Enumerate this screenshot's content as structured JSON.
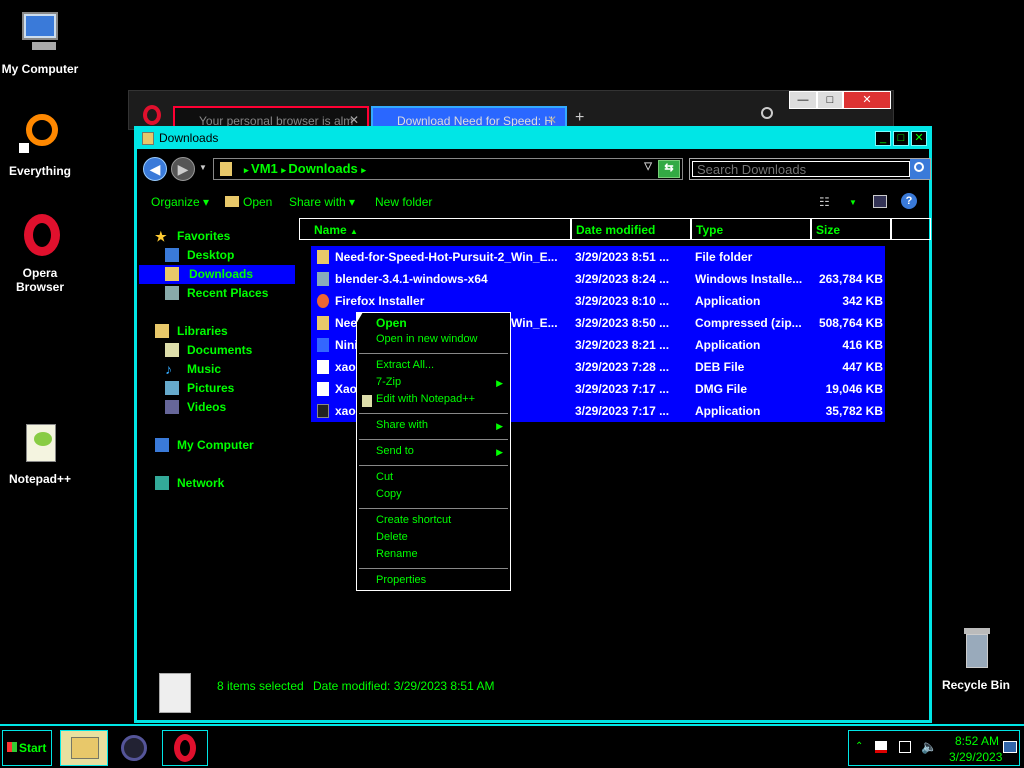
{
  "desktop": {
    "icons": [
      {
        "label": "My Computer"
      },
      {
        "label": "Everything"
      },
      {
        "label": "Opera Browser"
      },
      {
        "label": "Notepad++"
      },
      {
        "label": "Recycle Bin"
      }
    ]
  },
  "browser": {
    "tabs": [
      {
        "label": "Your personal browser is alm"
      },
      {
        "label": "Download Need for Speed: H"
      }
    ],
    "new_tab": "+"
  },
  "explorer": {
    "title": "Downloads",
    "breadcrumb": [
      "VM1",
      "Downloads"
    ],
    "search_placeholder": "Search Downloads",
    "toolbar": {
      "organize": "Organize",
      "open": "Open",
      "share_with": "Share with",
      "new_folder": "New folder"
    },
    "nav": {
      "favorites": "Favorites",
      "desktop": "Desktop",
      "downloads": "Downloads",
      "recent_places": "Recent Places",
      "libraries": "Libraries",
      "documents": "Documents",
      "music": "Music",
      "pictures": "Pictures",
      "videos": "Videos",
      "my_computer": "My Computer",
      "network": "Network"
    },
    "columns": {
      "name": "Name",
      "date": "Date modified",
      "type": "Type",
      "size": "Size"
    },
    "files": [
      {
        "name": "Need-for-Speed-Hot-Pursuit-2_Win_E...",
        "date": "3/29/2023 8:51 ...",
        "type": "File folder",
        "size": ""
      },
      {
        "name": "blender-3.4.1-windows-x64",
        "date": "3/29/2023 8:24 ...",
        "type": "Windows Installe...",
        "size": "263,784 KB"
      },
      {
        "name": "Firefox Installer",
        "date": "3/29/2023 8:10 ...",
        "type": "Application",
        "size": "342 KB"
      },
      {
        "name": "Need-for-Speed-Hot-Pursuit-2_Win_E...",
        "date": "3/29/2023 8:50 ...",
        "type": "Compressed (zip...",
        "size": "508,764 KB"
      },
      {
        "name": "Ninite Firefox ...",
        "date": "3/29/2023 8:21 ...",
        "type": "Application",
        "size": "416 KB"
      },
      {
        "name": "xao...deb",
        "date": "3/29/2023 7:28 ...",
        "type": "DEB File",
        "size": "447 KB"
      },
      {
        "name": "Xao...",
        "date": "3/29/2023 7:17 ...",
        "type": "DMG File",
        "size": "19,046 KB"
      },
      {
        "name": "xao...",
        "date": "3/29/2023 7:17 ...",
        "type": "Application",
        "size": "35,782 KB"
      }
    ],
    "status": {
      "selected": "8 items selected",
      "date": "Date modified: 3/29/2023 8:51 AM"
    }
  },
  "context_menu": {
    "open": "Open",
    "open_new_window": "Open in new window",
    "extract_all": "Extract All...",
    "seven_zip": "7-Zip",
    "edit_notepad": "Edit with Notepad++",
    "share_with": "Share with",
    "send_to": "Send to",
    "cut": "Cut",
    "copy": "Copy",
    "create_shortcut": "Create shortcut",
    "delete": "Delete",
    "rename": "Rename",
    "properties": "Properties"
  },
  "taskbar": {
    "start": "Start",
    "time": "8:52 AM",
    "date": "3/29/2023"
  },
  "colors": {
    "accent": "#00e6e6",
    "text": "#00ff00",
    "selection": "#0000ff"
  }
}
